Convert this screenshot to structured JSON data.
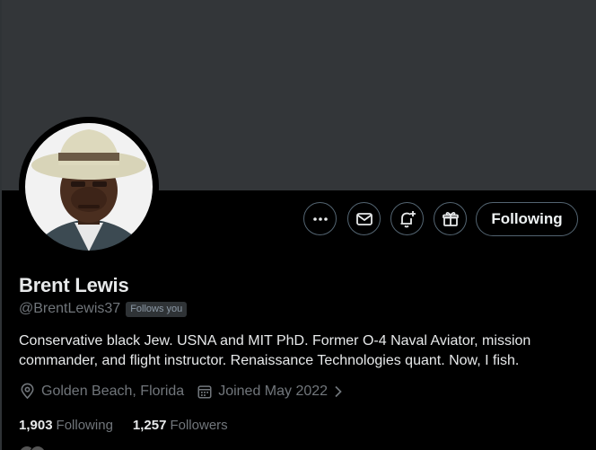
{
  "profile": {
    "name": "Brent Lewis",
    "handle": "@BrentLewis37",
    "follows_you": "Follows you",
    "bio": "Conservative black Jew. USNA and MIT PhD. Former O-4 Naval Aviator, mission commander, and flight instructor. Renaissance Technologies quant. Now, I fish.",
    "location": "Golden Beach, Florida",
    "joined": "Joined May 2022"
  },
  "actions": {
    "following_label": "Following"
  },
  "stats": {
    "following_count": "1,903",
    "following_label": "Following",
    "followers_count": "1,257",
    "followers_label": "Followers"
  },
  "icons": {
    "more": "more-icon",
    "message": "envelope-icon",
    "notify": "bell-plus-icon",
    "gift": "gift-icon",
    "location": "location-pin-icon",
    "calendar": "calendar-icon",
    "chevron": "chevron-right-icon"
  },
  "colors": {
    "background": "#000000",
    "banner": "#333639",
    "primary_text": "#e7e9ea",
    "secondary_text": "#71767b",
    "border": "#536471"
  }
}
